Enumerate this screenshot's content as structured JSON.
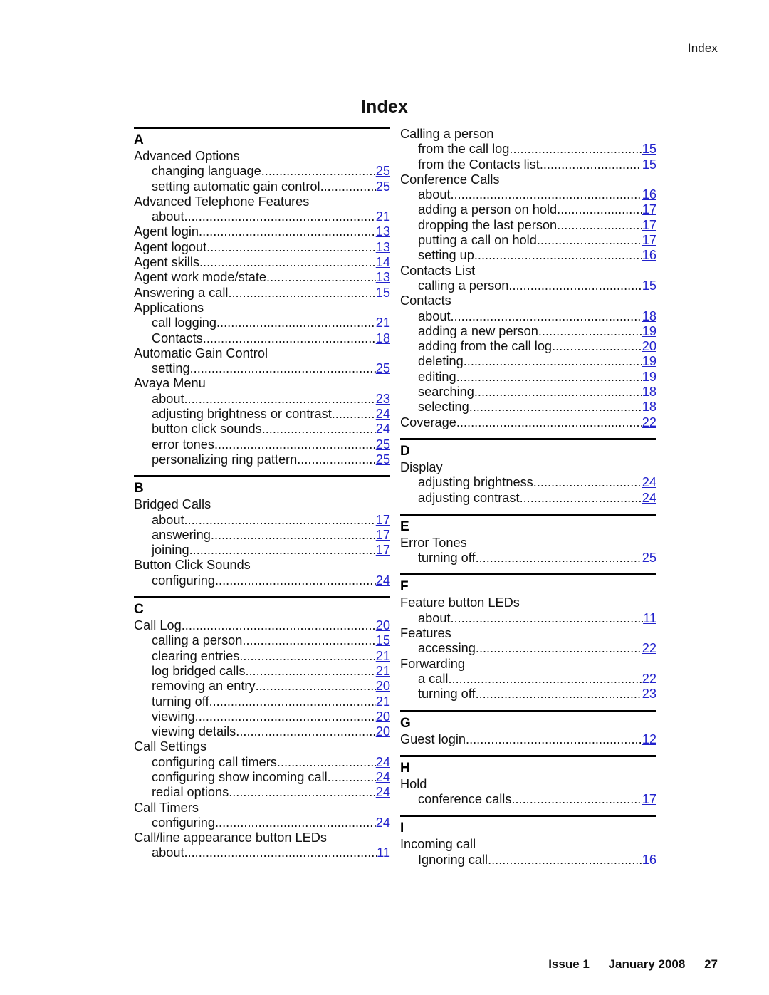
{
  "header": {
    "running_head": "Index"
  },
  "title": "Index",
  "colors": {
    "link": "#2222CC",
    "text": "#111111",
    "rule": "#000000"
  },
  "footer": {
    "issue": "Issue 1",
    "date": "January 2008",
    "page_number": "27"
  },
  "columns": [
    {
      "blocks": [
        {
          "letter": "A",
          "has_rule": true,
          "entries": [
            {
              "text": "Advanced Options",
              "page": null,
              "sub": false
            },
            {
              "text": "changing language",
              "page": "25",
              "sub": true
            },
            {
              "text": "setting automatic gain control",
              "page": "25",
              "sub": true
            },
            {
              "text": "Advanced Telephone Features",
              "page": null,
              "sub": false
            },
            {
              "text": "about",
              "page": "21",
              "sub": true
            },
            {
              "text": "Agent login",
              "page": "13",
              "sub": false
            },
            {
              "text": "Agent logout",
              "page": "13",
              "sub": false
            },
            {
              "text": "Agent skills",
              "page": "14",
              "sub": false
            },
            {
              "text": "Agent work mode/state",
              "page": "13",
              "sub": false
            },
            {
              "text": "Answering a call",
              "page": "15",
              "sub": false
            },
            {
              "text": "Applications",
              "page": null,
              "sub": false
            },
            {
              "text": "call logging",
              "page": "21",
              "sub": true
            },
            {
              "text": "Contacts",
              "page": "18",
              "sub": true
            },
            {
              "text": "Automatic Gain Control",
              "page": null,
              "sub": false
            },
            {
              "text": "setting",
              "page": "25",
              "sub": true
            },
            {
              "text": "Avaya Menu",
              "page": null,
              "sub": false
            },
            {
              "text": "about",
              "page": "23",
              "sub": true
            },
            {
              "text": "adjusting brightness or contrast",
              "page": "24",
              "sub": true
            },
            {
              "text": "button click sounds",
              "page": "24",
              "sub": true
            },
            {
              "text": "error tones",
              "page": "25",
              "sub": true
            },
            {
              "text": "personalizing ring pattern",
              "page": "25",
              "sub": true
            }
          ]
        },
        {
          "letter": "B",
          "has_rule": true,
          "entries": [
            {
              "text": "Bridged Calls",
              "page": null,
              "sub": false
            },
            {
              "text": "about",
              "page": "17",
              "sub": true
            },
            {
              "text": "answering",
              "page": "17",
              "sub": true
            },
            {
              "text": "joining",
              "page": "17",
              "sub": true
            },
            {
              "text": "Button Click Sounds",
              "page": null,
              "sub": false
            },
            {
              "text": "configuring",
              "page": "24",
              "sub": true
            }
          ]
        },
        {
          "letter": "C",
          "has_rule": true,
          "entries": [
            {
              "text": "Call Log",
              "page": "20",
              "sub": false
            },
            {
              "text": "calling a person",
              "page": "15",
              "sub": true
            },
            {
              "text": "clearing entries",
              "page": "21",
              "sub": true
            },
            {
              "text": "log bridged calls",
              "page": "21",
              "sub": true
            },
            {
              "text": "removing an entry",
              "page": "20",
              "sub": true
            },
            {
              "text": "turning off",
              "page": "21",
              "sub": true
            },
            {
              "text": "viewing",
              "page": "20",
              "sub": true
            },
            {
              "text": "viewing details",
              "page": "20",
              "sub": true
            },
            {
              "text": "Call Settings",
              "page": null,
              "sub": false
            },
            {
              "text": "configuring call timers",
              "page": "24",
              "sub": true
            },
            {
              "text": "configuring show incoming call",
              "page": "24",
              "sub": true
            },
            {
              "text": "redial options",
              "page": "24",
              "sub": true
            },
            {
              "text": "Call Timers",
              "page": null,
              "sub": false
            },
            {
              "text": "configuring",
              "page": "24",
              "sub": true
            },
            {
              "text": "Call/line appearance button LEDs",
              "page": null,
              "sub": false
            },
            {
              "text": "about",
              "page": "11",
              "sub": true
            }
          ]
        }
      ]
    },
    {
      "blocks": [
        {
          "letter": null,
          "has_rule": false,
          "entries": [
            {
              "text": "Calling a person",
              "page": null,
              "sub": false
            },
            {
              "text": "from the call log",
              "page": "15",
              "sub": true
            },
            {
              "text": "from the Contacts list",
              "page": "15",
              "sub": true
            },
            {
              "text": "Conference Calls",
              "page": null,
              "sub": false
            },
            {
              "text": "about",
              "page": "16",
              "sub": true
            },
            {
              "text": "adding a person on hold",
              "page": "17",
              "sub": true
            },
            {
              "text": "dropping the last person",
              "page": "17",
              "sub": true
            },
            {
              "text": "putting a call on hold",
              "page": "17",
              "sub": true
            },
            {
              "text": "setting up",
              "page": "16",
              "sub": true
            },
            {
              "text": "Contacts List",
              "page": null,
              "sub": false
            },
            {
              "text": "calling a person",
              "page": "15",
              "sub": true
            },
            {
              "text": "Contacts",
              "page": null,
              "sub": false
            },
            {
              "text": "about",
              "page": "18",
              "sub": true
            },
            {
              "text": "adding a new person",
              "page": "19",
              "sub": true
            },
            {
              "text": "adding from the call log",
              "page": "20",
              "sub": true
            },
            {
              "text": "deleting",
              "page": "19",
              "sub": true
            },
            {
              "text": "editing",
              "page": "19",
              "sub": true
            },
            {
              "text": "searching",
              "page": "18",
              "sub": true
            },
            {
              "text": "selecting",
              "page": "18",
              "sub": true
            },
            {
              "text": "Coverage",
              "page": "22",
              "sub": false
            }
          ]
        },
        {
          "letter": "D",
          "has_rule": true,
          "entries": [
            {
              "text": "Display",
              "page": null,
              "sub": false
            },
            {
              "text": "adjusting brightness",
              "page": "24",
              "sub": true
            },
            {
              "text": "adjusting contrast",
              "page": "24",
              "sub": true
            }
          ]
        },
        {
          "letter": "E",
          "has_rule": true,
          "entries": [
            {
              "text": "Error Tones",
              "page": null,
              "sub": false
            },
            {
              "text": "turning off",
              "page": "25",
              "sub": true
            }
          ]
        },
        {
          "letter": "F",
          "has_rule": true,
          "entries": [
            {
              "text": "Feature button LEDs",
              "page": null,
              "sub": false
            },
            {
              "text": "about",
              "page": "11",
              "sub": true
            },
            {
              "text": "Features",
              "page": null,
              "sub": false
            },
            {
              "text": "accessing",
              "page": "22",
              "sub": true
            },
            {
              "text": "Forwarding",
              "page": null,
              "sub": false
            },
            {
              "text": "a call",
              "page": "22",
              "sub": true
            },
            {
              "text": "turning off",
              "page": "23",
              "sub": true
            }
          ]
        },
        {
          "letter": "G",
          "has_rule": true,
          "entries": [
            {
              "text": "Guest login",
              "page": "12",
              "sub": false
            }
          ]
        },
        {
          "letter": "H",
          "has_rule": true,
          "entries": [
            {
              "text": "Hold",
              "page": null,
              "sub": false
            },
            {
              "text": "conference calls",
              "page": "17",
              "sub": true
            }
          ]
        },
        {
          "letter": "I",
          "has_rule": true,
          "entries": [
            {
              "text": "Incoming call",
              "page": null,
              "sub": false
            },
            {
              "text": "Ignoring call",
              "page": "16",
              "sub": true
            }
          ]
        }
      ]
    }
  ]
}
